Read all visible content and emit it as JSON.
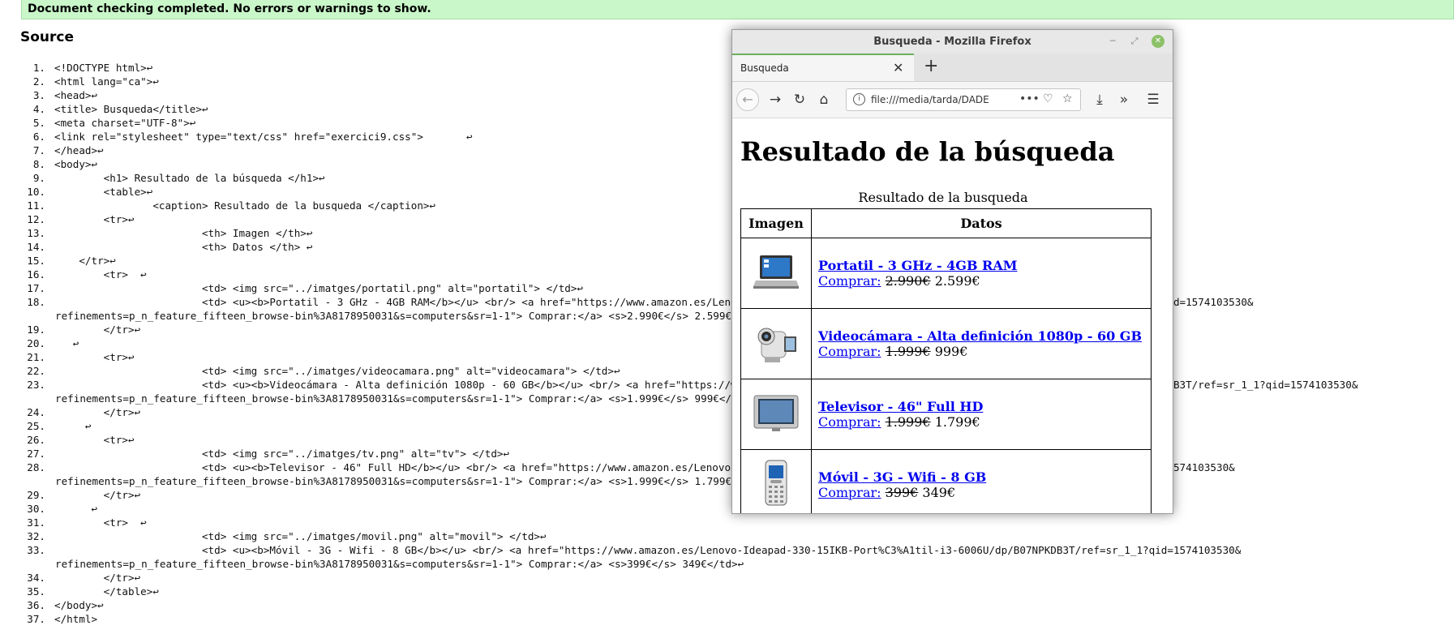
{
  "banner": {
    "text": "Document checking completed. No errors or warnings to show."
  },
  "source": {
    "heading": "Source",
    "lines": [
      {
        "n": "1.",
        "text": "<!DOCTYPE html>↩"
      },
      {
        "n": "2.",
        "text": "<html lang=\"ca\">↩"
      },
      {
        "n": "3.",
        "text": "<head>↩"
      },
      {
        "n": "4.",
        "text": "<title> Busqueda</title>↩"
      },
      {
        "n": "5.",
        "text": "<meta charset=\"UTF-8\">↩"
      },
      {
        "n": "6.",
        "text": "<link rel=\"stylesheet\" type=\"text/css\" href=\"exercici9.css\">       ↩"
      },
      {
        "n": "7.",
        "text": "</head>↩"
      },
      {
        "n": "8.",
        "text": "<body>↩"
      },
      {
        "n": "9.",
        "text": "        <h1> Resultado de la búsqueda </h1>↩"
      },
      {
        "n": "10.",
        "text": "        <table>↩"
      },
      {
        "n": "11.",
        "text": "                <caption> Resultado de la busqueda </caption>↩"
      },
      {
        "n": "12.",
        "text": "        <tr>↩"
      },
      {
        "n": "13.",
        "text": "                        <th> Imagen </th>↩"
      },
      {
        "n": "14.",
        "text": "                        <th> Datos </th> ↩"
      },
      {
        "n": "15.",
        "text": "    </tr>↩"
      },
      {
        "n": "16.",
        "text": "        <tr>  ↩"
      },
      {
        "n": "17.",
        "text": "                        <td> <img src=\"../imatges/portatil.png\" alt=\"portatil\"> </td>↩"
      },
      {
        "n": "18.",
        "text": "                        <td> <u><b>Portatil - 3 GHz - 4GB RAM</b></u> <br/> <a href=\"https://www.amazon.es/Lenovo-Ideapad-330-15IKB-Port%C3%A1til-i3-6006U/dp/B07NPKDB3T/ref=sr_1_1?qid=1574103530&",
        "wrap": "refinements=p_n_feature_fifteen_browse-bin%3A8178950031&s=computers&sr=1-1\"> Comprar:</a> <s>2.990€</s> 2.599€</td>↩"
      },
      {
        "n": "19.",
        "text": "        </tr>↩"
      },
      {
        "n": "20.",
        "text": "   ↩"
      },
      {
        "n": "21.",
        "text": "        <tr>↩"
      },
      {
        "n": "22.",
        "text": "                        <td> <img src=\"../imatges/videocamara.png\" alt=\"videocamara\"> </td>↩"
      },
      {
        "n": "23.",
        "text": "                        <td> <u><b>Videocámara - Alta definición 1080p - 60 GB</b></u> <br/> <a href=\"https://www.amazon.es/Lenovo-Ideapad-330-15IKB-Port%C3%A1til-i3-6006U/dp/B07NPKDB3T/ref=sr_1_1?qid=1574103530&",
        "wrap": "refinements=p_n_feature_fifteen_browse-bin%3A8178950031&s=computers&sr=1-1\"> Comprar:</a> <s>1.999€</s> 999€</td>↩"
      },
      {
        "n": "24.",
        "text": "        </tr>↩"
      },
      {
        "n": "25.",
        "text": "     ↩"
      },
      {
        "n": "26.",
        "text": "        <tr>↩"
      },
      {
        "n": "27.",
        "text": "                        <td> <img src=\"../imatges/tv.png\" alt=\"tv\"> </td>↩"
      },
      {
        "n": "28.",
        "text": "                        <td> <u><b>Televisor - 46\" Full HD</b></u> <br/> <a href=\"https://www.amazon.es/Lenovo-Ideapad-330-15IKB-Port%C3%A1til-i3-6006U/dp/B07NPKDB3T/ref=sr_1_1?qid=1574103530&",
        "wrap": "refinements=p_n_feature_fifteen_browse-bin%3A8178950031&s=computers&sr=1-1\"> Comprar:</a> <s>1.999€</s> 1.799€</td>↩"
      },
      {
        "n": "29.",
        "text": "        </tr>↩"
      },
      {
        "n": "30.",
        "text": "      ↩"
      },
      {
        "n": "31.",
        "text": "        <tr>  ↩"
      },
      {
        "n": "32.",
        "text": "                        <td> <img src=\"../imatges/movil.png\" alt=\"movil\"> </td>↩"
      },
      {
        "n": "33.",
        "text": "                        <td> <u><b>Móvil - 3G - Wifi - 8 GB</b></u> <br/> <a href=\"https://www.amazon.es/Lenovo-Ideapad-330-15IKB-Port%C3%A1til-i3-6006U/dp/B07NPKDB3T/ref=sr_1_1?qid=1574103530&",
        "wrap": "refinements=p_n_feature_fifteen_browse-bin%3A8178950031&s=computers&sr=1-1\"> Comprar:</a> <s>399€</s> 349€</td>↩"
      },
      {
        "n": "34.",
        "text": "        </tr>↩"
      },
      {
        "n": "35.",
        "text": "        </table>↩"
      },
      {
        "n": "36.",
        "text": "</body>↩"
      },
      {
        "n": "37.",
        "text": "</html>"
      }
    ]
  },
  "firefox": {
    "window_title": "Busqueda - Mozilla Firefox",
    "tab_label": "Busqueda",
    "url": "file:///media/tarda/DADE",
    "page": {
      "heading": "Resultado de la búsqueda",
      "caption": "Resultado de la busqueda",
      "col_imagen": "Imagen",
      "col_datos": "Datos",
      "buy_label": "Comprar:",
      "products": [
        {
          "name": "Portatil - 3 GHz - 4GB RAM",
          "old_price": "2.990€",
          "price": "2.599€",
          "icon": "laptop-icon"
        },
        {
          "name": "Videocámara - Alta definición 1080p - 60 GB",
          "old_price": "1.999€",
          "price": "999€",
          "icon": "videocamera-icon"
        },
        {
          "name": "Televisor - 46\" Full HD",
          "old_price": "1.999€",
          "price": "1.799€",
          "icon": "tv-icon"
        },
        {
          "name": "Móvil - 3G - Wifi - 8 GB",
          "old_price": "399€",
          "price": "349€",
          "icon": "mobile-phone-icon"
        }
      ]
    }
  }
}
